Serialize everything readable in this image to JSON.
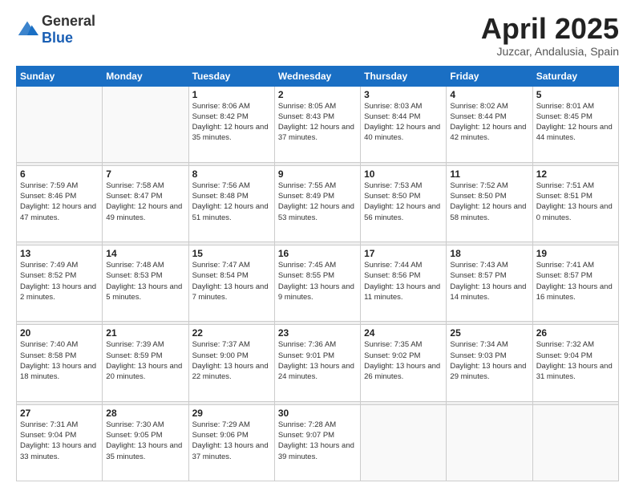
{
  "header": {
    "logo": {
      "text_general": "General",
      "text_blue": "Blue"
    },
    "title": "April 2025",
    "location": "Juzcar, Andalusia, Spain"
  },
  "calendar": {
    "days_of_week": [
      "Sunday",
      "Monday",
      "Tuesday",
      "Wednesday",
      "Thursday",
      "Friday",
      "Saturday"
    ],
    "weeks": [
      [
        {
          "day": "",
          "sunrise": "",
          "sunset": "",
          "daylight": "",
          "empty": true
        },
        {
          "day": "",
          "sunrise": "",
          "sunset": "",
          "daylight": "",
          "empty": true
        },
        {
          "day": "1",
          "sunrise": "Sunrise: 8:06 AM",
          "sunset": "Sunset: 8:42 PM",
          "daylight": "Daylight: 12 hours and 35 minutes."
        },
        {
          "day": "2",
          "sunrise": "Sunrise: 8:05 AM",
          "sunset": "Sunset: 8:43 PM",
          "daylight": "Daylight: 12 hours and 37 minutes."
        },
        {
          "day": "3",
          "sunrise": "Sunrise: 8:03 AM",
          "sunset": "Sunset: 8:44 PM",
          "daylight": "Daylight: 12 hours and 40 minutes."
        },
        {
          "day": "4",
          "sunrise": "Sunrise: 8:02 AM",
          "sunset": "Sunset: 8:44 PM",
          "daylight": "Daylight: 12 hours and 42 minutes."
        },
        {
          "day": "5",
          "sunrise": "Sunrise: 8:01 AM",
          "sunset": "Sunset: 8:45 PM",
          "daylight": "Daylight: 12 hours and 44 minutes."
        }
      ],
      [
        {
          "day": "6",
          "sunrise": "Sunrise: 7:59 AM",
          "sunset": "Sunset: 8:46 PM",
          "daylight": "Daylight: 12 hours and 47 minutes."
        },
        {
          "day": "7",
          "sunrise": "Sunrise: 7:58 AM",
          "sunset": "Sunset: 8:47 PM",
          "daylight": "Daylight: 12 hours and 49 minutes."
        },
        {
          "day": "8",
          "sunrise": "Sunrise: 7:56 AM",
          "sunset": "Sunset: 8:48 PM",
          "daylight": "Daylight: 12 hours and 51 minutes."
        },
        {
          "day": "9",
          "sunrise": "Sunrise: 7:55 AM",
          "sunset": "Sunset: 8:49 PM",
          "daylight": "Daylight: 12 hours and 53 minutes."
        },
        {
          "day": "10",
          "sunrise": "Sunrise: 7:53 AM",
          "sunset": "Sunset: 8:50 PM",
          "daylight": "Daylight: 12 hours and 56 minutes."
        },
        {
          "day": "11",
          "sunrise": "Sunrise: 7:52 AM",
          "sunset": "Sunset: 8:50 PM",
          "daylight": "Daylight: 12 hours and 58 minutes."
        },
        {
          "day": "12",
          "sunrise": "Sunrise: 7:51 AM",
          "sunset": "Sunset: 8:51 PM",
          "daylight": "Daylight: 13 hours and 0 minutes."
        }
      ],
      [
        {
          "day": "13",
          "sunrise": "Sunrise: 7:49 AM",
          "sunset": "Sunset: 8:52 PM",
          "daylight": "Daylight: 13 hours and 2 minutes."
        },
        {
          "day": "14",
          "sunrise": "Sunrise: 7:48 AM",
          "sunset": "Sunset: 8:53 PM",
          "daylight": "Daylight: 13 hours and 5 minutes."
        },
        {
          "day": "15",
          "sunrise": "Sunrise: 7:47 AM",
          "sunset": "Sunset: 8:54 PM",
          "daylight": "Daylight: 13 hours and 7 minutes."
        },
        {
          "day": "16",
          "sunrise": "Sunrise: 7:45 AM",
          "sunset": "Sunset: 8:55 PM",
          "daylight": "Daylight: 13 hours and 9 minutes."
        },
        {
          "day": "17",
          "sunrise": "Sunrise: 7:44 AM",
          "sunset": "Sunset: 8:56 PM",
          "daylight": "Daylight: 13 hours and 11 minutes."
        },
        {
          "day": "18",
          "sunrise": "Sunrise: 7:43 AM",
          "sunset": "Sunset: 8:57 PM",
          "daylight": "Daylight: 13 hours and 14 minutes."
        },
        {
          "day": "19",
          "sunrise": "Sunrise: 7:41 AM",
          "sunset": "Sunset: 8:57 PM",
          "daylight": "Daylight: 13 hours and 16 minutes."
        }
      ],
      [
        {
          "day": "20",
          "sunrise": "Sunrise: 7:40 AM",
          "sunset": "Sunset: 8:58 PM",
          "daylight": "Daylight: 13 hours and 18 minutes."
        },
        {
          "day": "21",
          "sunrise": "Sunrise: 7:39 AM",
          "sunset": "Sunset: 8:59 PM",
          "daylight": "Daylight: 13 hours and 20 minutes."
        },
        {
          "day": "22",
          "sunrise": "Sunrise: 7:37 AM",
          "sunset": "Sunset: 9:00 PM",
          "daylight": "Daylight: 13 hours and 22 minutes."
        },
        {
          "day": "23",
          "sunrise": "Sunrise: 7:36 AM",
          "sunset": "Sunset: 9:01 PM",
          "daylight": "Daylight: 13 hours and 24 minutes."
        },
        {
          "day": "24",
          "sunrise": "Sunrise: 7:35 AM",
          "sunset": "Sunset: 9:02 PM",
          "daylight": "Daylight: 13 hours and 26 minutes."
        },
        {
          "day": "25",
          "sunrise": "Sunrise: 7:34 AM",
          "sunset": "Sunset: 9:03 PM",
          "daylight": "Daylight: 13 hours and 29 minutes."
        },
        {
          "day": "26",
          "sunrise": "Sunrise: 7:32 AM",
          "sunset": "Sunset: 9:04 PM",
          "daylight": "Daylight: 13 hours and 31 minutes."
        }
      ],
      [
        {
          "day": "27",
          "sunrise": "Sunrise: 7:31 AM",
          "sunset": "Sunset: 9:04 PM",
          "daylight": "Daylight: 13 hours and 33 minutes."
        },
        {
          "day": "28",
          "sunrise": "Sunrise: 7:30 AM",
          "sunset": "Sunset: 9:05 PM",
          "daylight": "Daylight: 13 hours and 35 minutes."
        },
        {
          "day": "29",
          "sunrise": "Sunrise: 7:29 AM",
          "sunset": "Sunset: 9:06 PM",
          "daylight": "Daylight: 13 hours and 37 minutes."
        },
        {
          "day": "30",
          "sunrise": "Sunrise: 7:28 AM",
          "sunset": "Sunset: 9:07 PM",
          "daylight": "Daylight: 13 hours and 39 minutes."
        },
        {
          "day": "",
          "sunrise": "",
          "sunset": "",
          "daylight": "",
          "empty": true
        },
        {
          "day": "",
          "sunrise": "",
          "sunset": "",
          "daylight": "",
          "empty": true
        },
        {
          "day": "",
          "sunrise": "",
          "sunset": "",
          "daylight": "",
          "empty": true
        }
      ]
    ]
  }
}
